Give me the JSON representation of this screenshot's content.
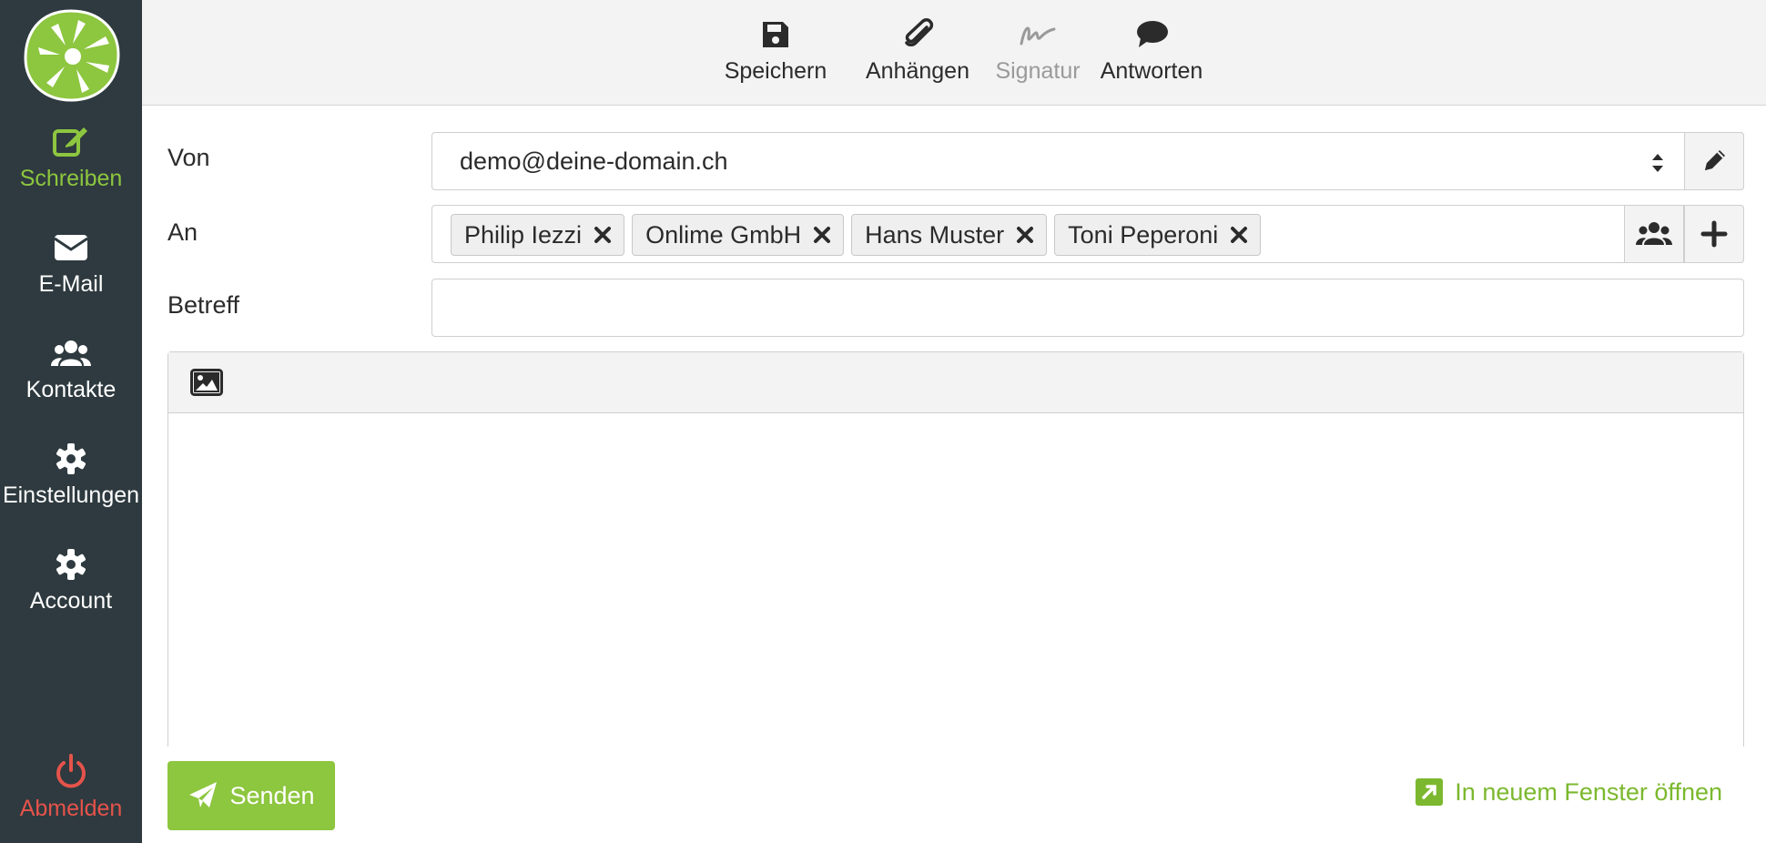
{
  "sidebar": {
    "items": [
      {
        "label": "Schreiben",
        "icon": "edit-icon"
      },
      {
        "label": "E-Mail",
        "icon": "envelope-icon"
      },
      {
        "label": "Kontakte",
        "icon": "users-icon"
      },
      {
        "label": "Einstellungen",
        "icon": "gear-icon"
      },
      {
        "label": "Account",
        "icon": "gear-icon"
      }
    ],
    "logout_label": "Abmelden"
  },
  "toolbar": {
    "save_label": "Speichern",
    "attach_label": "Anhängen",
    "signature_label": "Signatur",
    "reply_label": "Antworten"
  },
  "compose": {
    "from_label": "Von",
    "from_value": "demo@deine-domain.ch",
    "to_label": "An",
    "recipients": [
      "Philip Iezzi",
      "Onlime GmbH",
      "Hans Muster",
      "Toni Peperoni"
    ],
    "subject_label": "Betreff",
    "subject_value": ""
  },
  "footer": {
    "send_label": "Senden",
    "new_window_label": "In neuem Fenster öffnen"
  },
  "colors": {
    "accent": "#8dc63f",
    "sidebar_bg": "#2e3a3f",
    "logout": "#e5534b"
  }
}
